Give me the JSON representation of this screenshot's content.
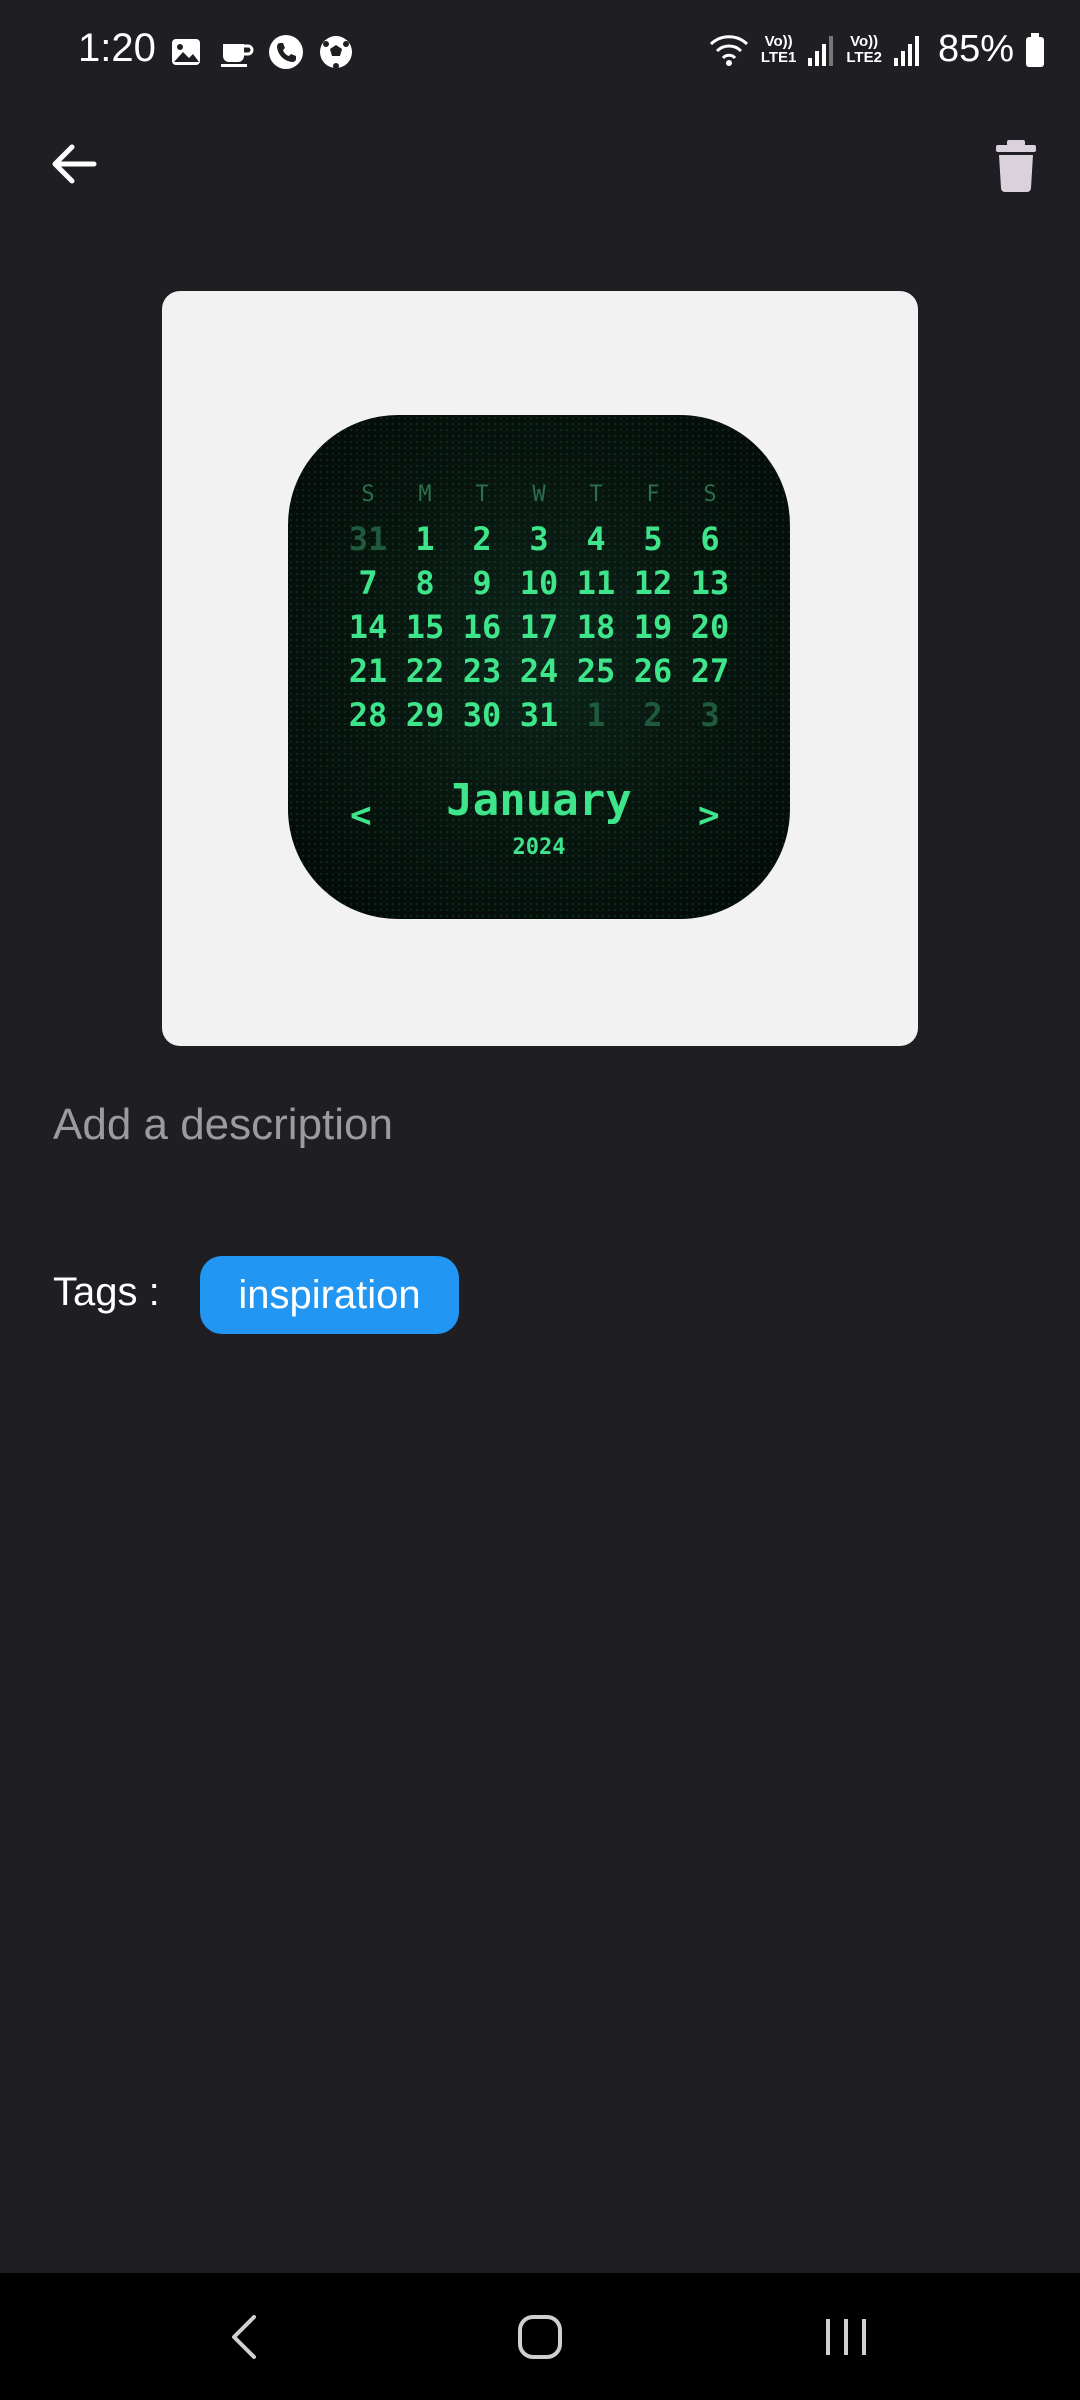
{
  "status_bar": {
    "time": "1:20",
    "lte1_top": "Vo))",
    "lte1_bottom": "LTE1",
    "lte2_top": "Vo))",
    "lte2_bottom": "LTE2",
    "battery": "85%",
    "icons": [
      "image-icon",
      "coffee-icon",
      "phone-icon",
      "soccer-ball-icon",
      "wifi-icon",
      "signal-icon",
      "battery-icon"
    ]
  },
  "app_bar": {
    "back_icon": "arrow-left-icon",
    "delete_icon": "trash-icon"
  },
  "image": {
    "calendar": {
      "weekdays": [
        "S",
        "M",
        "T",
        "W",
        "T",
        "F",
        "S"
      ],
      "weeks": [
        [
          "31",
          "1",
          "2",
          "3",
          "4",
          "5",
          "6"
        ],
        [
          "7",
          "8",
          "9",
          "10",
          "11",
          "12",
          "13"
        ],
        [
          "14",
          "15",
          "16",
          "17",
          "18",
          "19",
          "20"
        ],
        [
          "21",
          "22",
          "23",
          "24",
          "25",
          "26",
          "27"
        ],
        [
          "28",
          "29",
          "30",
          "31",
          "1",
          "2",
          "3"
        ]
      ],
      "prev": "<",
      "next": ">",
      "month": "January",
      "year": "2024",
      "accent_color": "#3ee58a"
    }
  },
  "description": {
    "placeholder": "Add a description"
  },
  "tags": {
    "label": "Tags :",
    "items": [
      "inspiration"
    ],
    "chip_color": "#2196f3"
  },
  "nav_bar": {
    "icons": [
      "nav-back-icon",
      "home-icon",
      "recents-icon"
    ]
  },
  "colors": {
    "background": "#1f1e22",
    "card": "#f2f2f2"
  }
}
